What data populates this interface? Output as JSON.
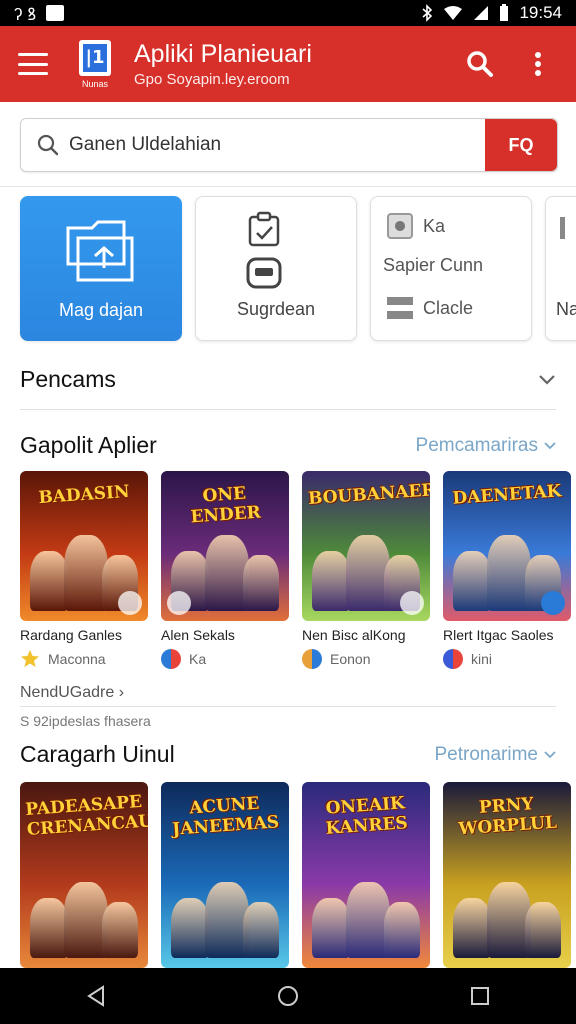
{
  "status_bar": {
    "left": "ʔ ꝸ",
    "time": "19:54"
  },
  "app_bar": {
    "title": "Apliki Planieuari",
    "subtitle": "Gpo Soyapin.ley.eroom",
    "logo_sub": "Nunas",
    "logo_glyph": "|1"
  },
  "search": {
    "value": "Ganen Uldelahian",
    "button_label": "FQ"
  },
  "cards": [
    {
      "label": "Mag dajan",
      "icon": "folder-add-icon"
    },
    {
      "label": "Sugrdean",
      "icon": "clipboard-icon"
    },
    {
      "rows": [
        "Ka",
        "Sapier Cunn",
        "Clacle"
      ]
    },
    {
      "label": "Na"
    }
  ],
  "section_pencams": {
    "title": "Pencams"
  },
  "section_popular": {
    "title": "Gapolit Aplier",
    "see_more": "Pemcamariras"
  },
  "popular_games": [
    {
      "banner": "BADASIN",
      "name": "Rardang Ganles",
      "meta": "Maconna",
      "palette": [
        "#5a1608",
        "#c33a14",
        "#f08a2a"
      ]
    },
    {
      "banner": "ONE ENDER",
      "name": "Alen Sekals",
      "meta": "Ka",
      "palette": [
        "#2b1648",
        "#6a2b7a",
        "#e0703a"
      ]
    },
    {
      "banner": "BOUBANAER",
      "name": "Nen Bisc alKong",
      "meta": "Eonon",
      "palette": [
        "#3a2a6b",
        "#4e8a3a",
        "#a8d860"
      ]
    },
    {
      "banner": "DAENETAK",
      "name": "Rlert Itgac Saoles",
      "meta": "kini",
      "palette": [
        "#1a3a7a",
        "#3a7ad8",
        "#e05a6a"
      ]
    }
  ],
  "more_link": "NendUGadre ›",
  "small_caption": "S 92ipdeslas fhasera",
  "section_category": {
    "title": "Caragarh Uinul",
    "see_more": "Petronarime"
  },
  "category_games": [
    {
      "banner": "PADEASAPE CRENANCAUS",
      "palette": [
        "#4a1810",
        "#b23a1c",
        "#e8883a"
      ]
    },
    {
      "banner": "ACUNE JANEEMAS",
      "palette": [
        "#0e2a5a",
        "#1a6ab8",
        "#58c8e8"
      ]
    },
    {
      "banner": "ONEAIK KANRES",
      "palette": [
        "#2a2a7a",
        "#8a3aa8",
        "#f0883a"
      ]
    },
    {
      "banner": "PRNY WORPLUL",
      "palette": [
        "#1a1a3a",
        "#c8a020",
        "#e8d04a"
      ]
    }
  ]
}
